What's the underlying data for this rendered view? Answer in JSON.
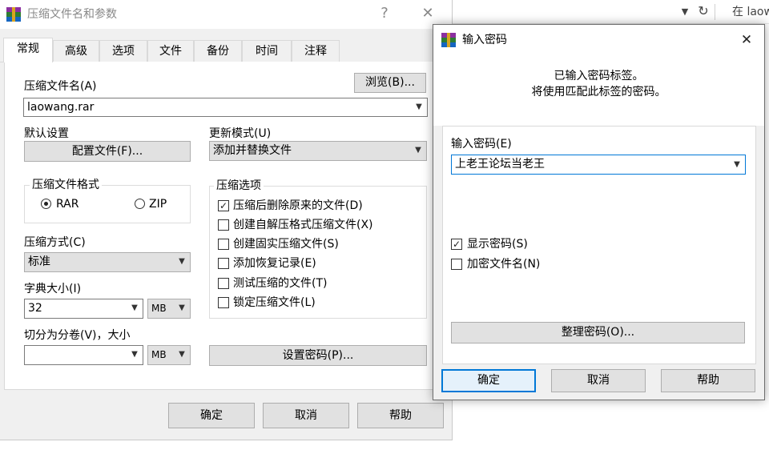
{
  "browser": {
    "dropdown_icon": "chevron-down-icon",
    "refresh_icon": "refresh-icon",
    "search_text": "在 laow"
  },
  "main_dialog": {
    "title": "压缩文件名和参数",
    "help_glyph": "?",
    "close_glyph": "✕",
    "tabs": [
      "常规",
      "高级",
      "选项",
      "文件",
      "备份",
      "时间",
      "注释"
    ],
    "archive_name_label": "压缩文件名(A)",
    "browse_button": "浏览(B)...",
    "archive_name_value": "laowang.rar",
    "default_settings_label": "默认设置",
    "profiles_button": "配置文件(F)...",
    "update_mode_label": "更新模式(U)",
    "update_mode_value": "添加并替换文件",
    "format_group_title": "压缩文件格式",
    "format_rar": "RAR",
    "format_zip": "ZIP",
    "format_selected": "RAR",
    "method_label": "压缩方式(C)",
    "method_value": "标准",
    "dict_label": "字典大小(I)",
    "dict_value": "32",
    "dict_unit": "MB",
    "split_label": "切分为分卷(V)，大小",
    "split_value": "",
    "split_unit": "MB",
    "options_group_title": "压缩选项",
    "options": [
      {
        "label": "压缩后删除原来的文件(D)",
        "checked": true
      },
      {
        "label": "创建自解压格式压缩文件(X)",
        "checked": false
      },
      {
        "label": "创建固实压缩文件(S)",
        "checked": false
      },
      {
        "label": "添加恢复记录(E)",
        "checked": false
      },
      {
        "label": "测试压缩的文件(T)",
        "checked": false
      },
      {
        "label": "锁定压缩文件(L)",
        "checked": false
      }
    ],
    "set_password_button": "设置密码(P)...",
    "ok_button": "确定",
    "cancel_button": "取消",
    "help_button": "帮助"
  },
  "password_dialog": {
    "title": "输入密码",
    "close_glyph": "✕",
    "info_line1": "已输入密码标签。",
    "info_line2": "将使用匹配此标签的密码。",
    "password_label": "输入密码(E)",
    "password_value": "上老王论坛当老王",
    "show_password_label": "显示密码(S)",
    "show_password_checked": true,
    "encrypt_names_label": "加密文件名(N)",
    "encrypt_names_checked": false,
    "organize_button": "整理密码(O)...",
    "ok_button": "确定",
    "cancel_button": "取消",
    "help_button": "帮助"
  },
  "colors": {
    "dialog_bg": "#f0f0f0",
    "button_bg": "#e1e1e1",
    "focus_border": "#0078d7"
  }
}
